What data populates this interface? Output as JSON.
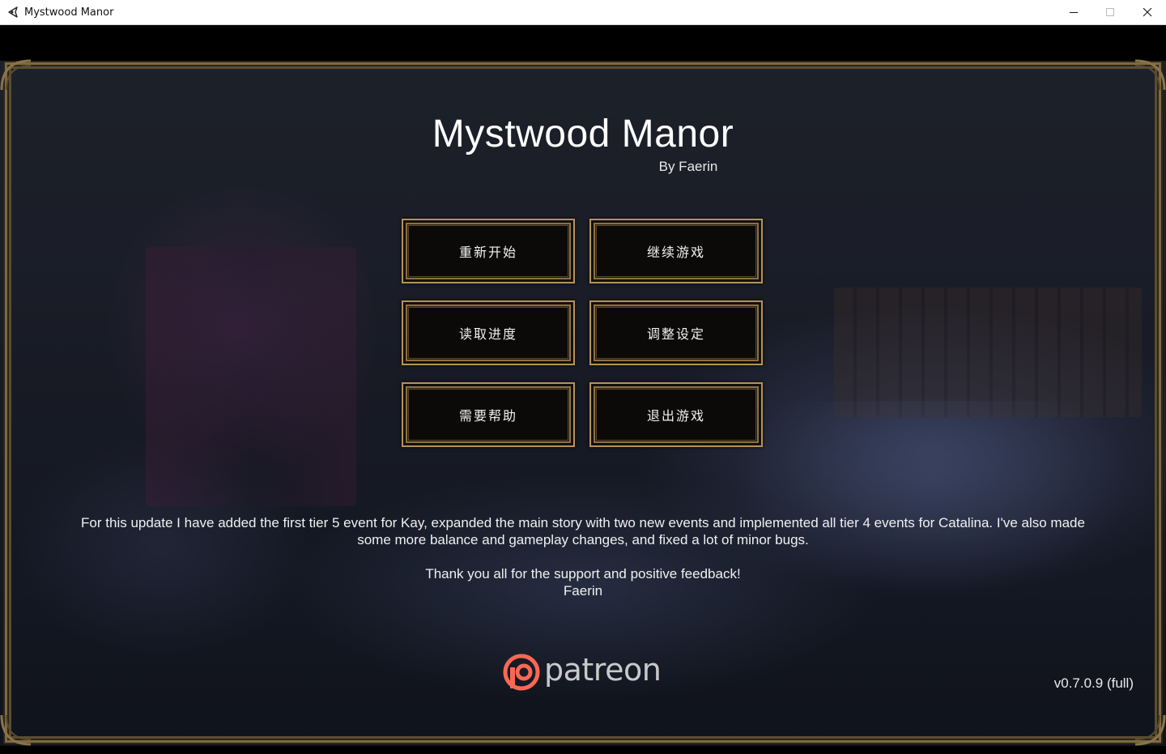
{
  "window": {
    "title": "Mystwood Manor",
    "icon": "renpy-icon"
  },
  "game": {
    "title": "Mystwood Manor",
    "author": "By Faerin"
  },
  "menu": {
    "start": "重新开始",
    "continue": "继续游戏",
    "load": "读取进度",
    "settings": "调整设定",
    "help": "需要帮助",
    "quit": "退出游戏"
  },
  "notes": {
    "update_line1": "For this update I have added the first tier 5 event for Kay, expanded the main story with two new events and implemented all tier 4 events for Catalina. I've also made",
    "update_line2": "some more balance and gameplay changes, and fixed a lot of minor bugs.",
    "thanks": "Thank you all for the support and positive feedback!",
    "signature": "Faerin"
  },
  "patreon": {
    "label": "patreon",
    "color": "#f96854"
  },
  "version": "v0.7.0.9 (full)",
  "colors": {
    "frame_gold": "#b6935a",
    "button_bg": "#0b0a08",
    "text": "#f0f0f0"
  }
}
